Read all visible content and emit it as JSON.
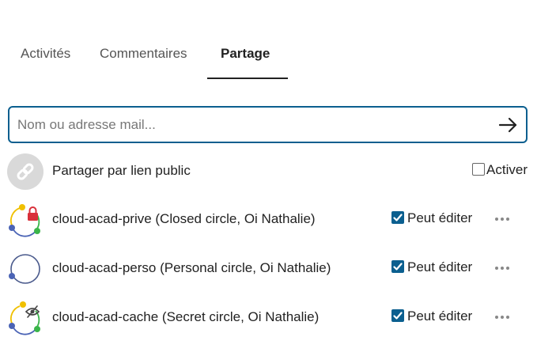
{
  "tabs": [
    {
      "label": "Activités",
      "active": false
    },
    {
      "label": "Commentaires",
      "active": false
    },
    {
      "label": "Partage",
      "active": true
    }
  ],
  "search": {
    "placeholder": "Nom ou adresse mail...",
    "value": ""
  },
  "public_link": {
    "label": "Partager par lien public",
    "toggle_label": "Activer",
    "checked": false,
    "icon": "link-icon"
  },
  "shares": [
    {
      "name": "cloud-acad-prive (Closed circle, Oi Nathalie)",
      "circle_type": "closed",
      "permission_label": "Peut éditer",
      "can_edit": true,
      "icon": "lock-icon"
    },
    {
      "name": "cloud-acad-perso (Personal circle, Oi Nathalie)",
      "circle_type": "personal",
      "permission_label": "Peut éditer",
      "can_edit": true,
      "icon": ""
    },
    {
      "name": "cloud-acad-cache (Secret circle, Oi Nathalie)",
      "circle_type": "secret",
      "permission_label": "Peut éditer",
      "can_edit": true,
      "icon": "eye-slash-icon"
    }
  ],
  "colors": {
    "accent": "#0b5f8f",
    "circle_yellow": "#f0c000",
    "circle_blue": "#4a63b5",
    "circle_green": "#3bb54a",
    "lock_red": "#d9303a",
    "link_gray": "#d9d9d9"
  }
}
